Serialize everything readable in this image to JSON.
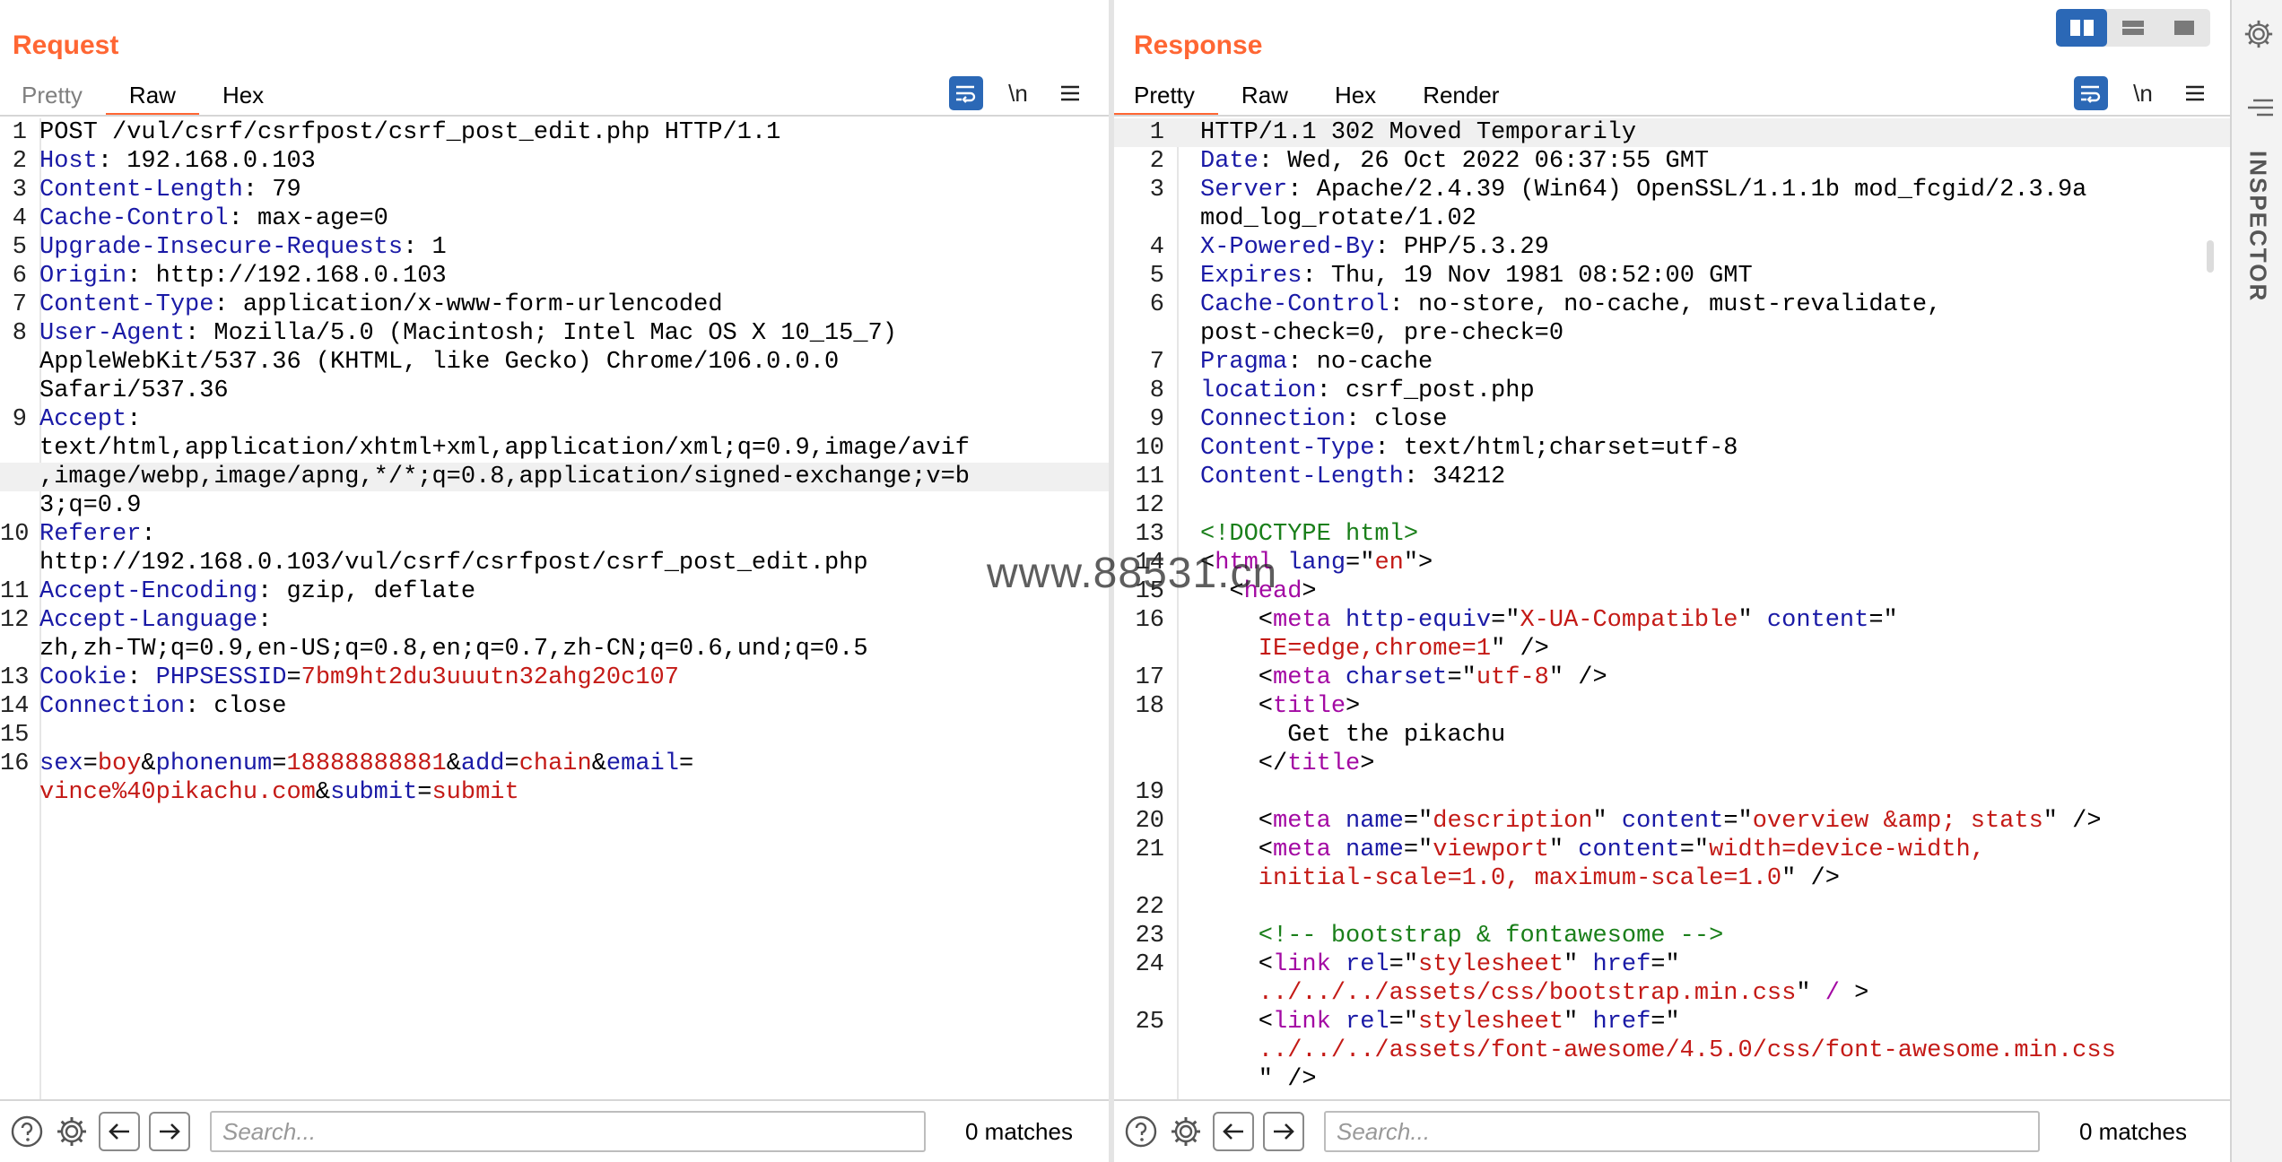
{
  "layout_toggle": {
    "options": [
      "side-by-side",
      "stacked",
      "single"
    ],
    "active": "side-by-side"
  },
  "request": {
    "title": "Request",
    "tabs": [
      "Pretty",
      "Raw",
      "Hex"
    ],
    "active_tab": "Raw",
    "newline_label": "\\n",
    "lines": [
      {
        "n": "1",
        "parts": [
          [
            "plain",
            "POST /vul/csrf/csrfpost/csrf_post_edit.php HTTP/1.1"
          ]
        ]
      },
      {
        "n": "2",
        "parts": [
          [
            "key",
            "Host"
          ],
          [
            "plain",
            ": 192.168.0.103"
          ]
        ]
      },
      {
        "n": "3",
        "parts": [
          [
            "key",
            "Content-Length"
          ],
          [
            "plain",
            ": 79"
          ]
        ]
      },
      {
        "n": "4",
        "parts": [
          [
            "key",
            "Cache-Control"
          ],
          [
            "plain",
            ": max-age=0"
          ]
        ]
      },
      {
        "n": "5",
        "parts": [
          [
            "key",
            "Upgrade-Insecure-Requests"
          ],
          [
            "plain",
            ": 1"
          ]
        ]
      },
      {
        "n": "6",
        "parts": [
          [
            "key",
            "Origin"
          ],
          [
            "plain",
            ": http://192.168.0.103"
          ]
        ]
      },
      {
        "n": "7",
        "parts": [
          [
            "key",
            "Content-Type"
          ],
          [
            "plain",
            ": application/x-www-form-urlencoded"
          ]
        ]
      },
      {
        "n": "8",
        "parts": [
          [
            "key",
            "User-Agent"
          ],
          [
            "plain",
            ": Mozilla/5.0 (Macintosh; Intel Mac OS X 10_15_7)"
          ]
        ]
      },
      {
        "n": "",
        "parts": [
          [
            "plain",
            "AppleWebKit/537.36 (KHTML, like Gecko) Chrome/106.0.0.0"
          ]
        ]
      },
      {
        "n": "",
        "parts": [
          [
            "plain",
            "Safari/537.36"
          ]
        ]
      },
      {
        "n": "9",
        "parts": [
          [
            "key",
            "Accept"
          ],
          [
            "plain",
            ":"
          ]
        ]
      },
      {
        "n": "",
        "parts": [
          [
            "plain",
            "text/html,application/xhtml+xml,application/xml;q=0.9,image/avif"
          ]
        ]
      },
      {
        "n": "",
        "hl": true,
        "parts": [
          [
            "plain",
            ",image/webp,image/apng,*/*;q=0.8,application/signed-exchange;v=b"
          ]
        ]
      },
      {
        "n": "",
        "parts": [
          [
            "plain",
            "3;q=0.9"
          ]
        ]
      },
      {
        "n": "10",
        "parts": [
          [
            "key",
            "Referer"
          ],
          [
            "plain",
            ":"
          ]
        ]
      },
      {
        "n": "",
        "parts": [
          [
            "plain",
            "http://192.168.0.103/vul/csrf/csrfpost/csrf_post_edit.php"
          ]
        ]
      },
      {
        "n": "11",
        "parts": [
          [
            "key",
            "Accept-Encoding"
          ],
          [
            "plain",
            ": gzip, deflate"
          ]
        ]
      },
      {
        "n": "12",
        "parts": [
          [
            "key",
            "Accept-Language"
          ],
          [
            "plain",
            ":"
          ]
        ]
      },
      {
        "n": "",
        "parts": [
          [
            "plain",
            "zh,zh-TW;q=0.9,en-US;q=0.8,en;q=0.7,zh-CN;q=0.6,und;q=0.5"
          ]
        ]
      },
      {
        "n": "13",
        "parts": [
          [
            "key",
            "Cookie"
          ],
          [
            "plain",
            ": "
          ],
          [
            "blue",
            "PHPSESSID"
          ],
          [
            "plain",
            "="
          ],
          [
            "red",
            "7bm9ht2du3uuutn32ahg20c107"
          ]
        ]
      },
      {
        "n": "14",
        "parts": [
          [
            "key",
            "Connection"
          ],
          [
            "plain",
            ": close"
          ]
        ]
      },
      {
        "n": "15",
        "parts": [
          [
            "plain",
            ""
          ]
        ]
      },
      {
        "n": "16",
        "parts": [
          [
            "blue",
            "sex"
          ],
          [
            "plain",
            "="
          ],
          [
            "red",
            "boy"
          ],
          [
            "plain",
            "&"
          ],
          [
            "blue",
            "phonenum"
          ],
          [
            "plain",
            "="
          ],
          [
            "red",
            "18888888881"
          ],
          [
            "plain",
            "&"
          ],
          [
            "blue",
            "add"
          ],
          [
            "plain",
            "="
          ],
          [
            "red",
            "chain"
          ],
          [
            "plain",
            "&"
          ],
          [
            "blue",
            "email"
          ],
          [
            "plain",
            "="
          ]
        ]
      },
      {
        "n": "",
        "parts": [
          [
            "red",
            "vince%40pikachu.com"
          ],
          [
            "plain",
            "&"
          ],
          [
            "blue",
            "submit"
          ],
          [
            "plain",
            "="
          ],
          [
            "red",
            "submit"
          ]
        ]
      }
    ],
    "search_placeholder": "Search...",
    "matches": "0 matches"
  },
  "response": {
    "title": "Response",
    "tabs": [
      "Pretty",
      "Raw",
      "Hex",
      "Render"
    ],
    "active_tab": "Pretty",
    "newline_label": "\\n",
    "lines": [
      {
        "n": "1",
        "hl": true,
        "parts": [
          [
            "plain",
            "HTTP/1.1 302 Moved Temporarily"
          ]
        ]
      },
      {
        "n": "2",
        "parts": [
          [
            "key",
            "Date"
          ],
          [
            "plain",
            ": Wed, 26 Oct 2022 06:37:55 GMT"
          ]
        ]
      },
      {
        "n": "3",
        "parts": [
          [
            "key",
            "Server"
          ],
          [
            "plain",
            ": Apache/2.4.39 (Win64) OpenSSL/1.1.1b mod_fcgid/2.3.9a"
          ]
        ]
      },
      {
        "n": "",
        "parts": [
          [
            "plain",
            "mod_log_rotate/1.02"
          ]
        ]
      },
      {
        "n": "4",
        "parts": [
          [
            "key",
            "X-Powered-By"
          ],
          [
            "plain",
            ": PHP/5.3.29"
          ]
        ]
      },
      {
        "n": "5",
        "parts": [
          [
            "key",
            "Expires"
          ],
          [
            "plain",
            ": Thu, 19 Nov 1981 08:52:00 GMT"
          ]
        ]
      },
      {
        "n": "6",
        "parts": [
          [
            "key",
            "Cache-Control"
          ],
          [
            "plain",
            ": no-store, no-cache, must-revalidate,"
          ]
        ]
      },
      {
        "n": "",
        "parts": [
          [
            "plain",
            "post-check=0, pre-check=0"
          ]
        ]
      },
      {
        "n": "7",
        "parts": [
          [
            "key",
            "Pragma"
          ],
          [
            "plain",
            ": no-cache"
          ]
        ]
      },
      {
        "n": "8",
        "parts": [
          [
            "key",
            "location"
          ],
          [
            "plain",
            ": csrf_post.php"
          ]
        ]
      },
      {
        "n": "9",
        "parts": [
          [
            "key",
            "Connection"
          ],
          [
            "plain",
            ": close"
          ]
        ]
      },
      {
        "n": "10",
        "parts": [
          [
            "key",
            "Content-Type"
          ],
          [
            "plain",
            ": text/html;charset=utf-8"
          ]
        ]
      },
      {
        "n": "11",
        "parts": [
          [
            "key",
            "Content-Length"
          ],
          [
            "plain",
            ": 34212"
          ]
        ]
      },
      {
        "n": "12",
        "parts": [
          [
            "plain",
            ""
          ]
        ]
      },
      {
        "n": "13",
        "parts": [
          [
            "doctype",
            "<!DOCTYPE html>"
          ]
        ]
      },
      {
        "n": "14",
        "parts": [
          [
            "plain",
            "<"
          ],
          [
            "tag",
            "html"
          ],
          [
            "plain",
            " "
          ],
          [
            "attr",
            "lang"
          ],
          [
            "plain",
            "=\""
          ],
          [
            "str",
            "en"
          ],
          [
            "plain",
            "\">"
          ]
        ]
      },
      {
        "n": "15",
        "parts": [
          [
            "plain",
            "  <"
          ],
          [
            "tag",
            "head"
          ],
          [
            "plain",
            ">"
          ]
        ]
      },
      {
        "n": "16",
        "parts": [
          [
            "plain",
            "    <"
          ],
          [
            "tag",
            "meta"
          ],
          [
            "plain",
            " "
          ],
          [
            "attr",
            "http-equiv"
          ],
          [
            "plain",
            "=\""
          ],
          [
            "str",
            "X-UA-Compatible"
          ],
          [
            "plain",
            "\" "
          ],
          [
            "attr",
            "content"
          ],
          [
            "plain",
            "=\""
          ]
        ]
      },
      {
        "n": "",
        "parts": [
          [
            "str",
            "    IE=edge,chrome=1"
          ],
          [
            "plain",
            "\" />"
          ]
        ]
      },
      {
        "n": "17",
        "parts": [
          [
            "plain",
            "    <"
          ],
          [
            "tag",
            "meta"
          ],
          [
            "plain",
            " "
          ],
          [
            "attr",
            "charset"
          ],
          [
            "plain",
            "=\""
          ],
          [
            "str",
            "utf-8"
          ],
          [
            "plain",
            "\" />"
          ]
        ]
      },
      {
        "n": "18",
        "parts": [
          [
            "plain",
            "    <"
          ],
          [
            "tag",
            "title"
          ],
          [
            "plain",
            ">"
          ]
        ]
      },
      {
        "n": "",
        "parts": [
          [
            "plain",
            "      Get the pikachu"
          ]
        ]
      },
      {
        "n": "",
        "parts": [
          [
            "plain",
            "    </"
          ],
          [
            "tag",
            "title"
          ],
          [
            "plain",
            ">"
          ]
        ]
      },
      {
        "n": "19",
        "parts": [
          [
            "plain",
            ""
          ]
        ]
      },
      {
        "n": "20",
        "parts": [
          [
            "plain",
            "    <"
          ],
          [
            "tag",
            "meta"
          ],
          [
            "plain",
            " "
          ],
          [
            "attr",
            "name"
          ],
          [
            "plain",
            "=\""
          ],
          [
            "str",
            "description"
          ],
          [
            "plain",
            "\" "
          ],
          [
            "attr",
            "content"
          ],
          [
            "plain",
            "=\""
          ],
          [
            "str",
            "overview &amp; stats"
          ],
          [
            "plain",
            "\" />"
          ]
        ]
      },
      {
        "n": "21",
        "parts": [
          [
            "plain",
            "    <"
          ],
          [
            "tag",
            "meta"
          ],
          [
            "plain",
            " "
          ],
          [
            "attr",
            "name"
          ],
          [
            "plain",
            "=\""
          ],
          [
            "str",
            "viewport"
          ],
          [
            "plain",
            "\" "
          ],
          [
            "attr",
            "content"
          ],
          [
            "plain",
            "=\""
          ],
          [
            "str",
            "width=device-width,"
          ]
        ]
      },
      {
        "n": "",
        "parts": [
          [
            "str",
            "    initial-scale=1.0, maximum-scale=1.0"
          ],
          [
            "plain",
            "\" />"
          ]
        ]
      },
      {
        "n": "22",
        "parts": [
          [
            "plain",
            ""
          ]
        ]
      },
      {
        "n": "23",
        "parts": [
          [
            "comment",
            "    <!-- bootstrap & fontawesome -->"
          ]
        ]
      },
      {
        "n": "24",
        "parts": [
          [
            "plain",
            "    <"
          ],
          [
            "tag",
            "link"
          ],
          [
            "plain",
            " "
          ],
          [
            "attr",
            "rel"
          ],
          [
            "plain",
            "=\""
          ],
          [
            "str",
            "stylesheet"
          ],
          [
            "plain",
            "\" "
          ],
          [
            "attr",
            "href"
          ],
          [
            "plain",
            "=\""
          ]
        ]
      },
      {
        "n": "",
        "parts": [
          [
            "str",
            "    ../../../assets/css/bootstrap.min.css"
          ],
          [
            "plain",
            "\" "
          ],
          [
            "tag",
            "/"
          ],
          [
            "plain",
            " >"
          ]
        ]
      },
      {
        "n": "25",
        "parts": [
          [
            "plain",
            "    <"
          ],
          [
            "tag",
            "link"
          ],
          [
            "plain",
            " "
          ],
          [
            "attr",
            "rel"
          ],
          [
            "plain",
            "=\""
          ],
          [
            "str",
            "stylesheet"
          ],
          [
            "plain",
            "\" "
          ],
          [
            "attr",
            "href"
          ],
          [
            "plain",
            "=\""
          ]
        ]
      },
      {
        "n": "",
        "parts": [
          [
            "str",
            "    ../../../assets/font-awesome/4.5.0/css/font-awesome.min.css"
          ]
        ]
      },
      {
        "n": "",
        "parts": [
          [
            "plain",
            "    \" />"
          ]
        ]
      }
    ],
    "search_placeholder": "Search...",
    "matches": "0 matches"
  },
  "inspector": {
    "label": "INSPECTOR"
  },
  "watermark": "www.88531.cn"
}
